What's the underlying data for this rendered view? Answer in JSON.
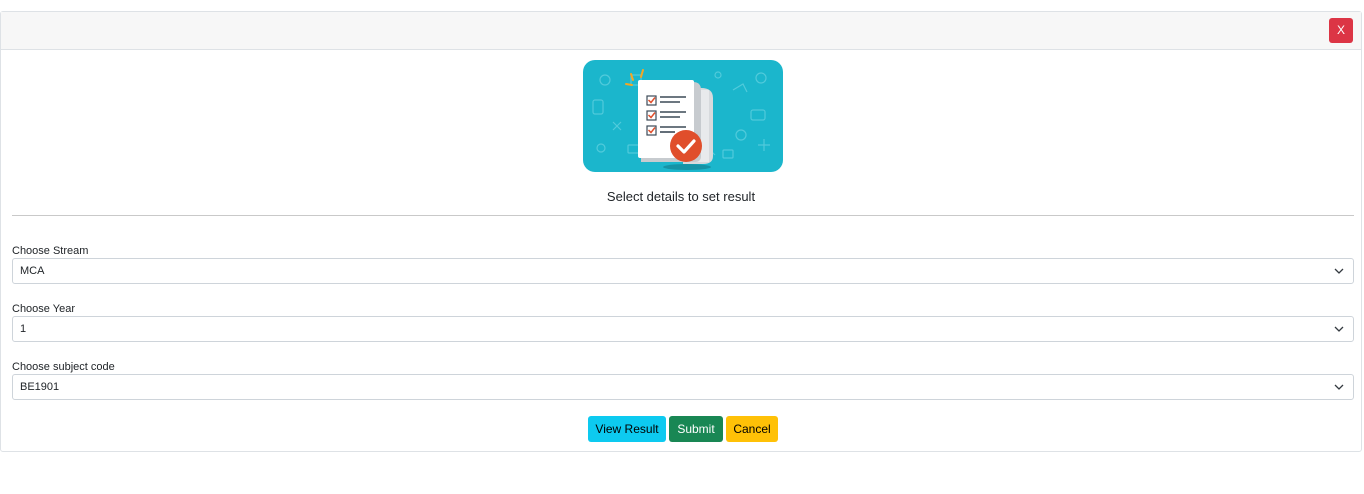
{
  "dialog": {
    "close_label": "X",
    "heading": "Select details to set result"
  },
  "fields": [
    {
      "label": "Choose Stream",
      "value": "MCA"
    },
    {
      "label": "Choose Year",
      "value": "1"
    },
    {
      "label": "Choose subject code",
      "value": "BE1901"
    }
  ],
  "buttons": {
    "view_result": "View Result",
    "submit": "Submit",
    "cancel": "Cancel"
  },
  "colors": {
    "close": "#dc3545",
    "view_result": "#0dcaf0",
    "submit": "#198754",
    "cancel": "#ffc107",
    "illustration_bg": "#1bb6cc"
  },
  "icons": {
    "illustration": "checklist-document-illustration",
    "select_arrow": "chevron-down-icon"
  }
}
